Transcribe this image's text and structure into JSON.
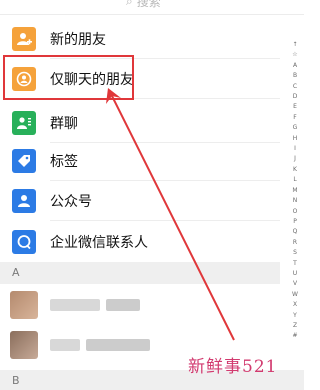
{
  "search": {
    "placeholder": "搜索"
  },
  "menu_items": [
    {
      "label": "新的朋友",
      "icon": "add-friend-icon",
      "color": "#f5a23b"
    },
    {
      "label": "仅聊天的朋友",
      "icon": "chat-only-friend-icon",
      "color": "#f5a23b"
    },
    {
      "label": "群聊",
      "icon": "group-chat-icon",
      "color": "#28b05a"
    },
    {
      "label": "标签",
      "icon": "tag-icon",
      "color": "#2c7be5"
    },
    {
      "label": "公众号",
      "icon": "official-account-icon",
      "color": "#2c7be5"
    },
    {
      "label": "企业微信联系人",
      "icon": "enterprise-contact-icon",
      "color": "#2c7be5"
    }
  ],
  "section": {
    "letter": "A"
  },
  "bottom_section": {
    "letter": "B"
  },
  "index_letters": [
    "↑",
    "☆",
    "A",
    "B",
    "C",
    "D",
    "E",
    "F",
    "G",
    "H",
    "I",
    "J",
    "K",
    "L",
    "M",
    "N",
    "O",
    "P",
    "Q",
    "R",
    "S",
    "T",
    "U",
    "V",
    "W",
    "X",
    "Y",
    "Z",
    "#"
  ],
  "watermark": {
    "text": "新鲜事521"
  },
  "colors": {
    "highlight": "#e0373a",
    "arrow": "#e0373a"
  }
}
